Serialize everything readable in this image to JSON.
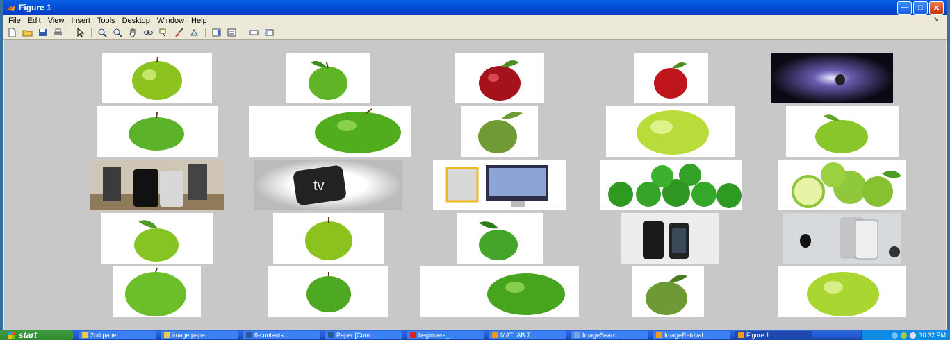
{
  "window": {
    "title": "Figure 1"
  },
  "menubar": {
    "items": [
      "File",
      "Edit",
      "View",
      "Insert",
      "Tools",
      "Desktop",
      "Window",
      "Help"
    ],
    "dock_glyph": "↘"
  },
  "toolbar": {
    "icons": [
      "new-figure-icon",
      "open-file-icon",
      "save-icon",
      "print-icon",
      "edit-plot-arrow-icon",
      "zoom-in-icon",
      "zoom-out-icon",
      "pan-hand-icon",
      "rotate-3d-icon",
      "data-cursor-icon",
      "brush-icon",
      "link-plot-icon",
      "colorbar-icon",
      "legend-icon",
      "hide-plot-tools-icon",
      "show-plot-tools-icon"
    ]
  },
  "grid": {
    "rows": [
      [
        "green-apple",
        "green-apple-leaf",
        "red-apple",
        "red-apple",
        "apple-logo-dark"
      ],
      [
        "green-apple",
        "green-apple",
        "green-apple-leaf",
        "green-apple",
        "green-apple-leaf"
      ],
      [
        "iphone-photo",
        "apple-tv",
        "imac",
        "apple-pile",
        "apple-halves"
      ],
      [
        "green-apple-leaf",
        "green-apple",
        "green-apple-leaf",
        "iphone-cases",
        "iphone-apple-logo"
      ],
      [
        "green-apple",
        "green-apple",
        "green-apple",
        "green-apple-leaf",
        "green-apple"
      ]
    ],
    "apple_tv_text": "tv"
  },
  "taskbar": {
    "start_label": "start",
    "tasks": [
      "2nd paper",
      "image pape...",
      "6-contents ...",
      "Paper [Com...",
      "beginners_t...",
      "MATLAB 7....",
      "ImageSearc...",
      "ImageRetrival",
      "Figure 1"
    ],
    "active_task": "Figure 1",
    "clock": "10:32 PM"
  },
  "colors": {
    "title_bar": "#0451d6",
    "canvas": "#c8c8c8",
    "taskbar": "#245edc",
    "apple_green": "#7cc520",
    "apple_red": "#b5131c"
  }
}
